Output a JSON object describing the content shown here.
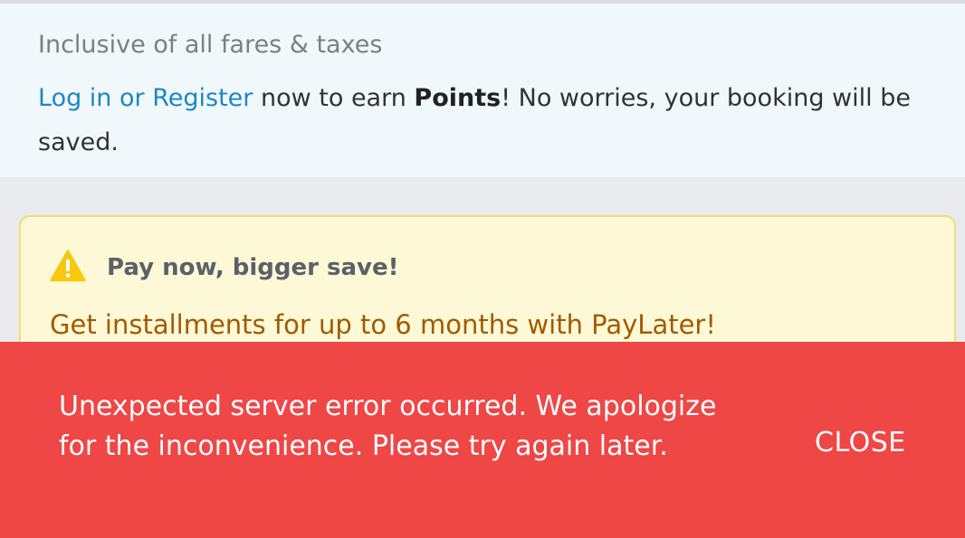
{
  "price_info": {
    "fare_note": "Inclusive of all fares & taxes",
    "login_link": "Log in or Register",
    "login_text_1": " now to earn ",
    "login_points": "Points",
    "login_text_2": "! No worries, your booking will be saved."
  },
  "promo": {
    "icon": "warning-icon",
    "title": "Pay now, bigger save!",
    "text": "Get installments for up to 6 months with PayLater!"
  },
  "snackbar": {
    "message": "Unexpected server error occurred. We apologize for the inconvenience. Please try again later.",
    "close_label": "CLOSE"
  },
  "colors": {
    "link": "#1d86c8",
    "promo_background": "#fdf9d6",
    "promo_border": "#f3dd73",
    "promo_text": "#a35a00",
    "warning_icon": "#f6c90e",
    "error_background": "#ef4646"
  }
}
